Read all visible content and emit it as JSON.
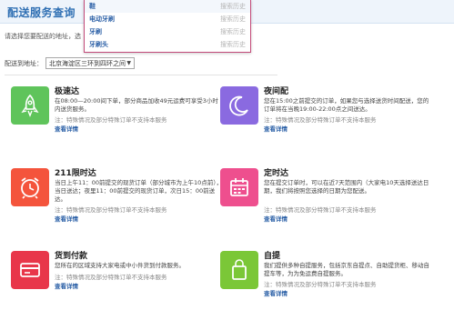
{
  "header": {
    "title": "配送服务查询"
  },
  "intro": {
    "text": "请选择您要配送的地址，选"
  },
  "dropdown": {
    "items": [
      {
        "text": "鞋",
        "hint": "搜索历史"
      },
      {
        "text": "电动牙刷",
        "hint": "搜索历史"
      },
      {
        "text": "牙刷",
        "hint": "搜索历史"
      },
      {
        "text": "牙刷头",
        "hint": "搜索历史"
      }
    ]
  },
  "area": {
    "label": "配送到地址：",
    "value": "北京海淀区三环到四环之间"
  },
  "services": [
    {
      "title": "极速达",
      "desc": "在08:00—20:00间下单，部分商品加收49元运费可享受3小时内送货服务。",
      "note": "注：特殊情况及部分特殊订单不支持本服务",
      "link": "查看详情",
      "color": "#5fc45b",
      "icon": "rocket-icon"
    },
    {
      "title": "夜间配",
      "desc": "您在15:00之前提交的订单，如果您与选择送货时间配送，您的订单将在当晚19:00-22:00点之间送达。",
      "note": "注：特殊情况及部分特殊订单不支持本服务",
      "link": "查看详情",
      "color": "#8a6ae0",
      "icon": "moon-icon"
    },
    {
      "title": "211限时达",
      "desc": "当日上午11：00前提交的现货订单（部分城市为上午10点前），当日送达；夜里11：00前提交的现货订单，次日15：00前送达。",
      "note": "注：特殊情况及部分特殊订单不支持本服务",
      "link": "查看详情",
      "color": "#f4543c",
      "icon": "alarm-clock-icon"
    },
    {
      "title": "定时达",
      "desc": "您在提交订单时，可以在近7天范围内（大家电10天选择送达日期，我们将按照您选择的日期为您配送。",
      "note": "注：特殊情况及部分特殊订单不支持本服务",
      "link": "查看详情",
      "color": "#ee4f8e",
      "icon": "calendar-icon"
    },
    {
      "title": "货到付款",
      "desc": "您所在的区域支持大家电或中小件货到付款服务。",
      "note": "注：特殊情况及部分特殊订单不支持本服务",
      "link": "查看详情",
      "color": "#e8364a",
      "icon": "credit-card-icon"
    },
    {
      "title": "自提",
      "desc": "我们提供多种自提服务，包括京东自提点、自助提货柜、移动自提车等，为为免运费自提服务。",
      "note": "注：特殊情况及部分特殊订单不支持本服务",
      "link": "查看详情",
      "color": "#7bc737",
      "icon": "shopping-bag-icon"
    }
  ]
}
